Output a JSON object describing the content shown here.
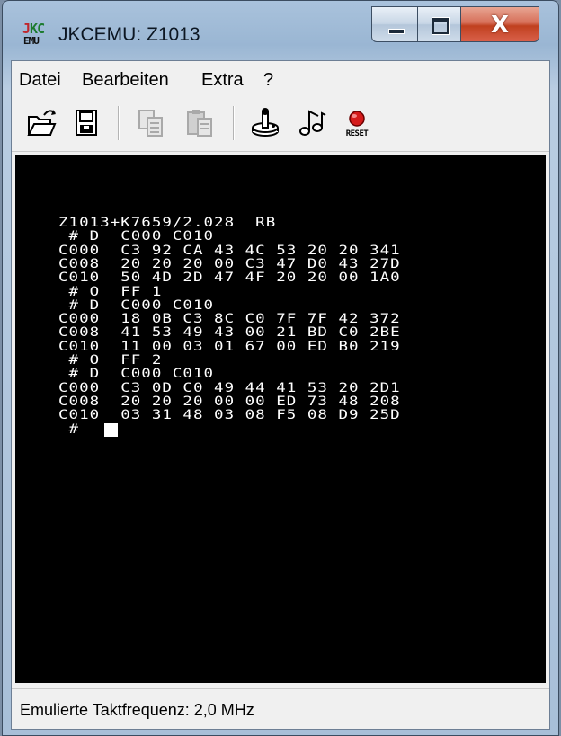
{
  "window": {
    "title": "JKCEMU: Z1013"
  },
  "app_icon": {
    "line1_j": "J",
    "line1_k": "K",
    "line1_c": "C",
    "line2": "EMU"
  },
  "title_controls": {
    "close_glyph": "X"
  },
  "menu": [
    {
      "label": "Datei"
    },
    {
      "label": "Bearbeiten"
    },
    {
      "label": "Extra"
    },
    {
      "label": "?"
    }
  ],
  "toolbar": {
    "icons": [
      "open-folder-icon",
      "save-disk-icon",
      "copy-icon",
      "paste-icon",
      "joystick-icon",
      "music-note-icon",
      "reset-icon"
    ],
    "reset_label": "RESET",
    "disabled_color": "#a9a9a9"
  },
  "screen": {
    "lines": [
      "Z1013+K7659/2.028  RB",
      " # D  C000 C010",
      "C000  C3 92 CA 43 4C 53 20 20 341",
      "C008  20 20 20 00 C3 47 D0 43 27D",
      "C010  50 4D 2D 47 4F 20 20 00 1A0",
      " # O  FF 1",
      " # D  C000 C010",
      "C000  18 0B C3 8C C0 7F 7F 42 372",
      "C008  41 53 49 43 00 21 BD C0 2BE",
      "C010  11 00 03 01 67 00 ED B0 219",
      " # O  FF 2",
      " # D  C000 C010",
      "C000  C3 0D C0 49 44 41 53 20 2D1",
      "C008  20 20 20 00 00 ED 73 48 208",
      "C010  03 31 48 03 08 F5 08 D9 25D",
      " #"
    ],
    "foreground": "#ffffff",
    "background": "#000000"
  },
  "status": {
    "text": "Emulierte Taktfrequenz: 2,0 MHz"
  }
}
